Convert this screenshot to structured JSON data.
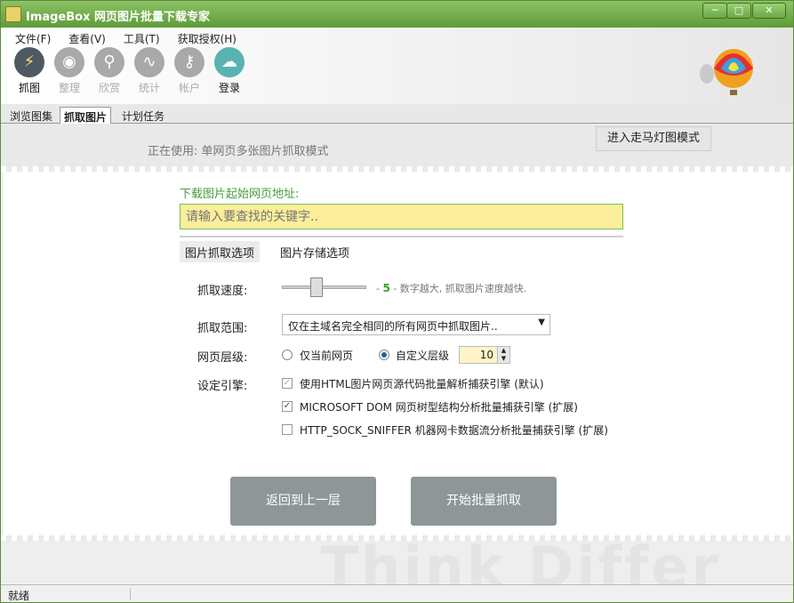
{
  "window": {
    "title": "ImageBox 网页图片批量下载专家",
    "min_glyph": "─",
    "max_glyph": "□",
    "close_glyph": "✕"
  },
  "menu": [
    "文件(F)",
    "查看(V)",
    "工具(T)",
    "获取授权(H)"
  ],
  "toolbar": [
    {
      "label": "抓图",
      "icon": "lightning-icon",
      "glyph": "⚡"
    },
    {
      "label": "整理",
      "icon": "eye-icon",
      "glyph": "◉"
    },
    {
      "label": "欣赏",
      "icon": "magnifier-icon",
      "glyph": "⚲"
    },
    {
      "label": "统计",
      "icon": "chart-line-icon",
      "glyph": "∿"
    },
    {
      "label": "帐户",
      "icon": "key-icon",
      "glyph": "⚷"
    },
    {
      "label": "登录",
      "icon": "cloud-upload-icon",
      "glyph": "☁"
    }
  ],
  "tabs": [
    "浏览图集",
    "抓取图片",
    "计划任务"
  ],
  "status_area": {
    "mode_text": "正在使用: 单网页多张图片抓取模式",
    "marquee_button": "进入走马灯图模式"
  },
  "form": {
    "url_label": "下载图片起始网页地址:",
    "url_placeholder": "请输入要查找的关键字..",
    "subtabs": [
      "图片抓取选项",
      "图片存储选项"
    ],
    "speed_label": "抓取速度:",
    "speed_value": "5",
    "speed_dash": "-",
    "speed_desc": "- 数字越大, 抓取图片速度越快.",
    "speed_fraction": 0.4,
    "range_label": "抓取范围:",
    "range_value": "仅在主域名完全相同的所有网页中抓取图片..",
    "dropdown_arrow": "▼",
    "level_label": "网页层级:",
    "level_opt1": "仅当前网页",
    "level_opt2": "自定义层级",
    "level_value": "10",
    "spin_up": "▲",
    "spin_down": "▼",
    "engine_label": "设定引擎:",
    "engine_opt1": "使用HTML图片网页源代码批量解析捕获引擎 (默认)",
    "engine_opt2": "MICROSOFT DOM 网页树型结构分析批量捕获引擎 (扩展)",
    "engine_opt3": "HTTP_SOCK_SNIFFER 机器网卡数据流分析批量捕获引擎 (扩展)",
    "check_glyph": "✓"
  },
  "buttons": {
    "back": "返回到上一层",
    "start": "开始批量抓取"
  },
  "watermark": "Think Differ",
  "statusbar": {
    "text": "就绪"
  }
}
